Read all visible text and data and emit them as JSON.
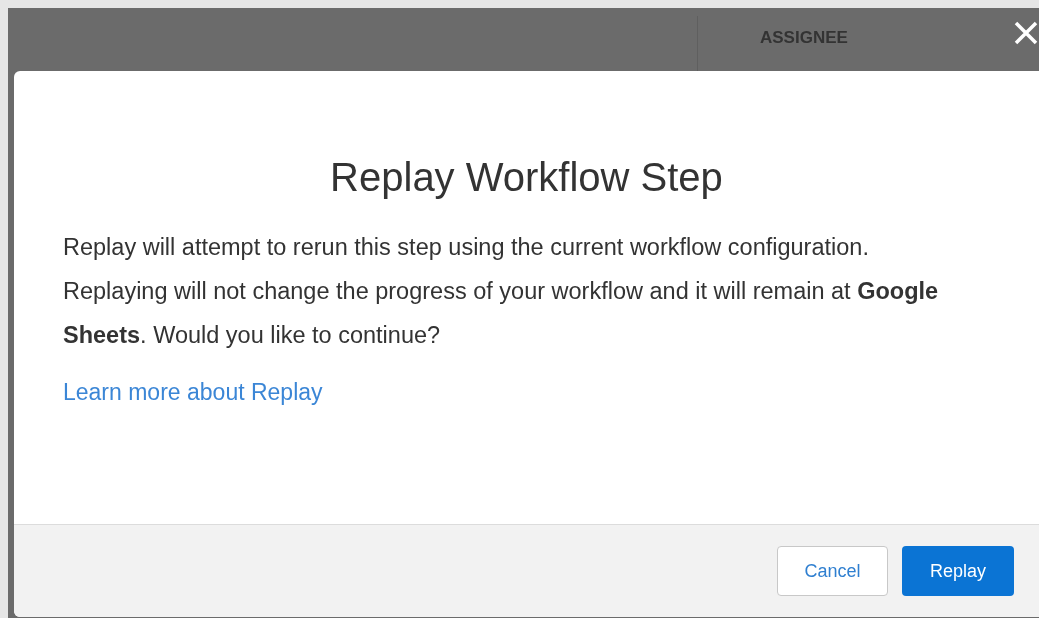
{
  "background": {
    "column_header": "ASSIGNEE"
  },
  "dialog": {
    "title": "Replay Workflow Step",
    "paragraph": "Replay will attempt to rerun this step using the current workflow configuration. Replaying will not change the progress of your workflow and it will remain at **Google Sheets**. Would you like to continue?",
    "link": "Learn more about Replay",
    "buttons": [
      {
        "label": "Cancel",
        "kind": "secondary"
      },
      {
        "label": "Replay",
        "kind": "primary"
      }
    ]
  }
}
